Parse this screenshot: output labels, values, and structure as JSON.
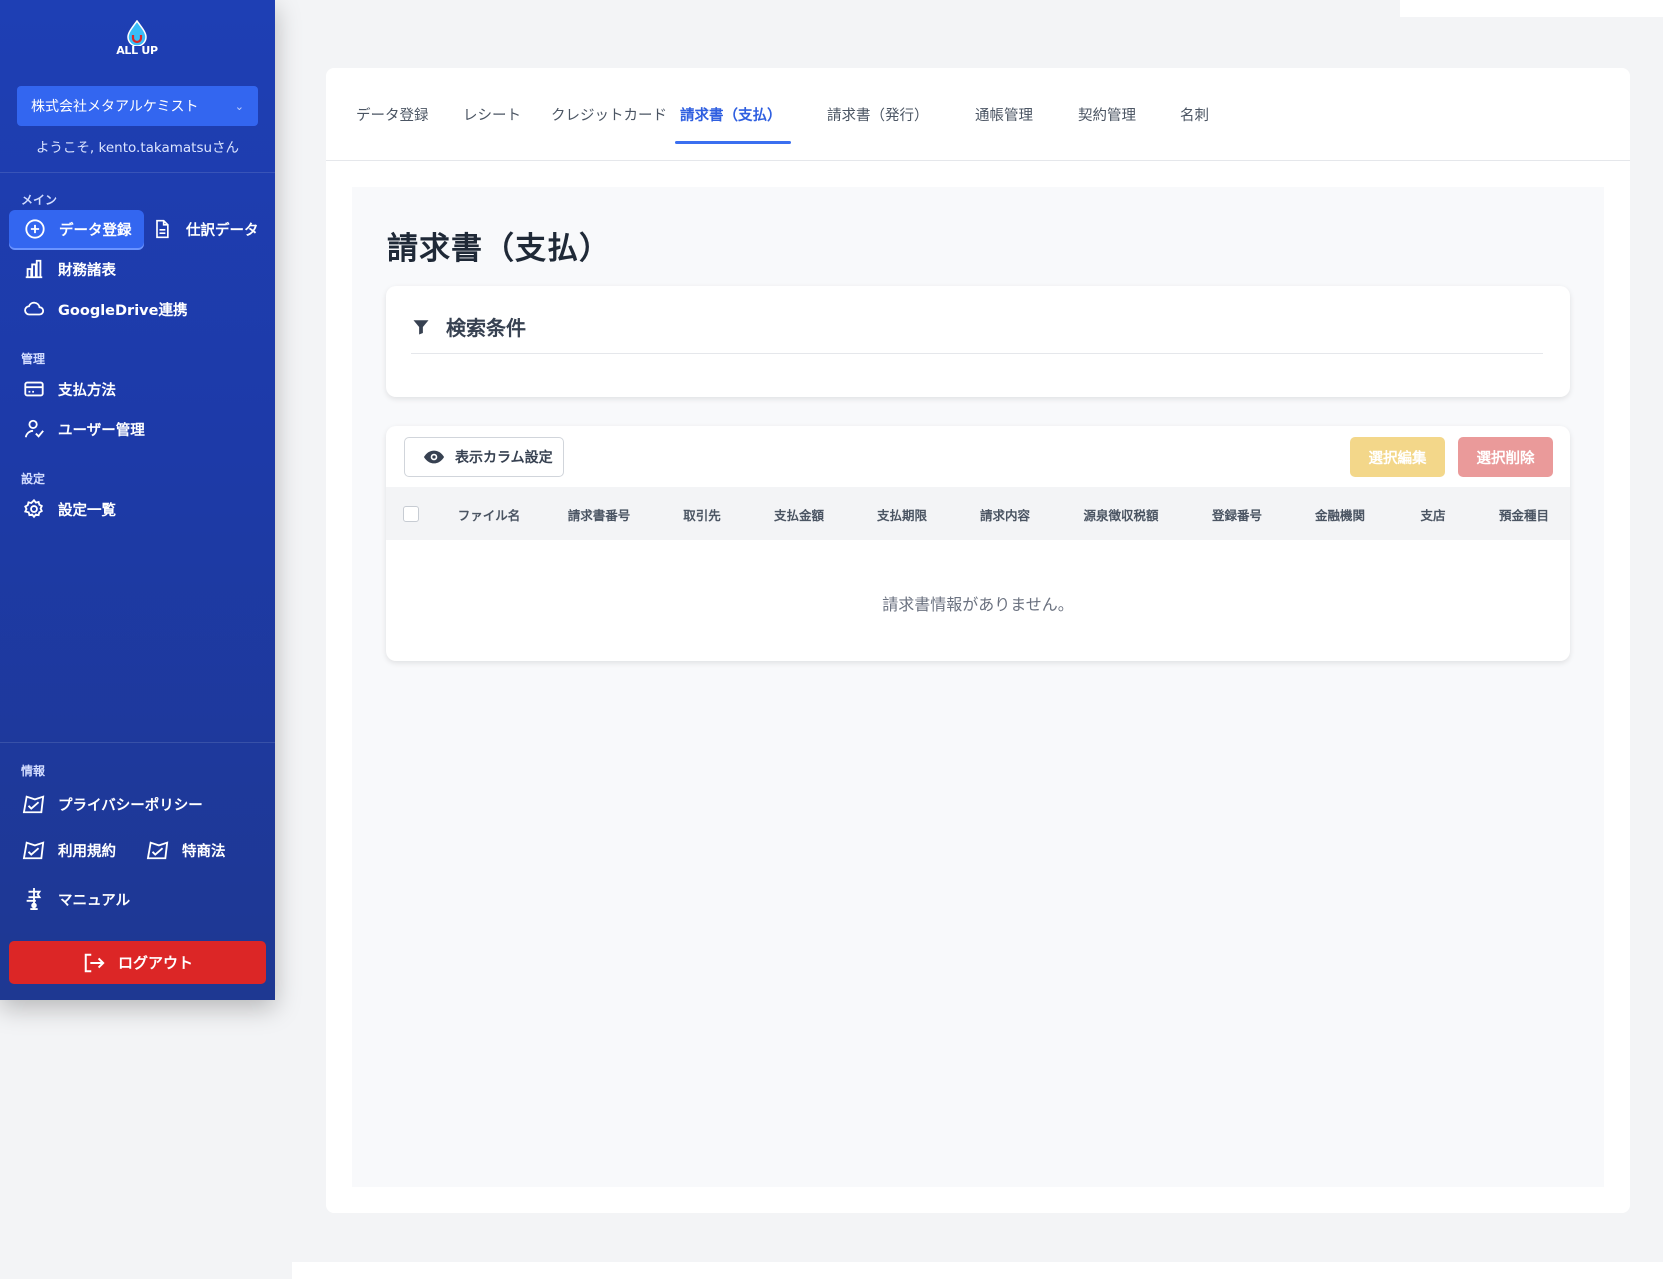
{
  "sidebar": {
    "logo_text": "ALL UP",
    "company": "株式会社メタアルケミスト",
    "welcome": "ようこそ, kento.takamatsuさん",
    "sections": {
      "main": "メイン",
      "manage": "管理",
      "settings": "設定",
      "info": "情報"
    },
    "items": {
      "data_register": "データ登録",
      "journal": "仕訳データ",
      "financial": "財務諸表",
      "gdrive": "GoogleDrive連携",
      "payment": "支払方法",
      "users": "ユーザー管理",
      "settings_list": "設定一覧",
      "privacy": "プライバシーポリシー",
      "terms": "利用規約",
      "tokushoho": "特商法",
      "manual": "マニュアル"
    },
    "logout": "ログアウト"
  },
  "tabs": [
    "データ登録",
    "レシート",
    "クレジットカード",
    "請求書（支払）",
    "請求書（発行）",
    "通帳管理",
    "契約管理",
    "名刺"
  ],
  "active_tab": 3,
  "page": {
    "title": "請求書（支払）",
    "search_title": "検索条件",
    "column_settings": "表示カラム設定",
    "edit_selected": "選択編集",
    "delete_selected": "選択削除",
    "columns": [
      "ファイル名",
      "請求書番号",
      "取引先",
      "支払金額",
      "支払期限",
      "請求内容",
      "源泉徴収税額",
      "登録番号",
      "金融機関",
      "支店",
      "預金種目"
    ],
    "empty_message": "請求書情報がありません。"
  },
  "colors": {
    "sidebar": "#1e3fb4",
    "accent": "#3366f0",
    "logout": "#dc2626",
    "edit": "#f3d78a",
    "delete": "#ea9a9a"
  }
}
